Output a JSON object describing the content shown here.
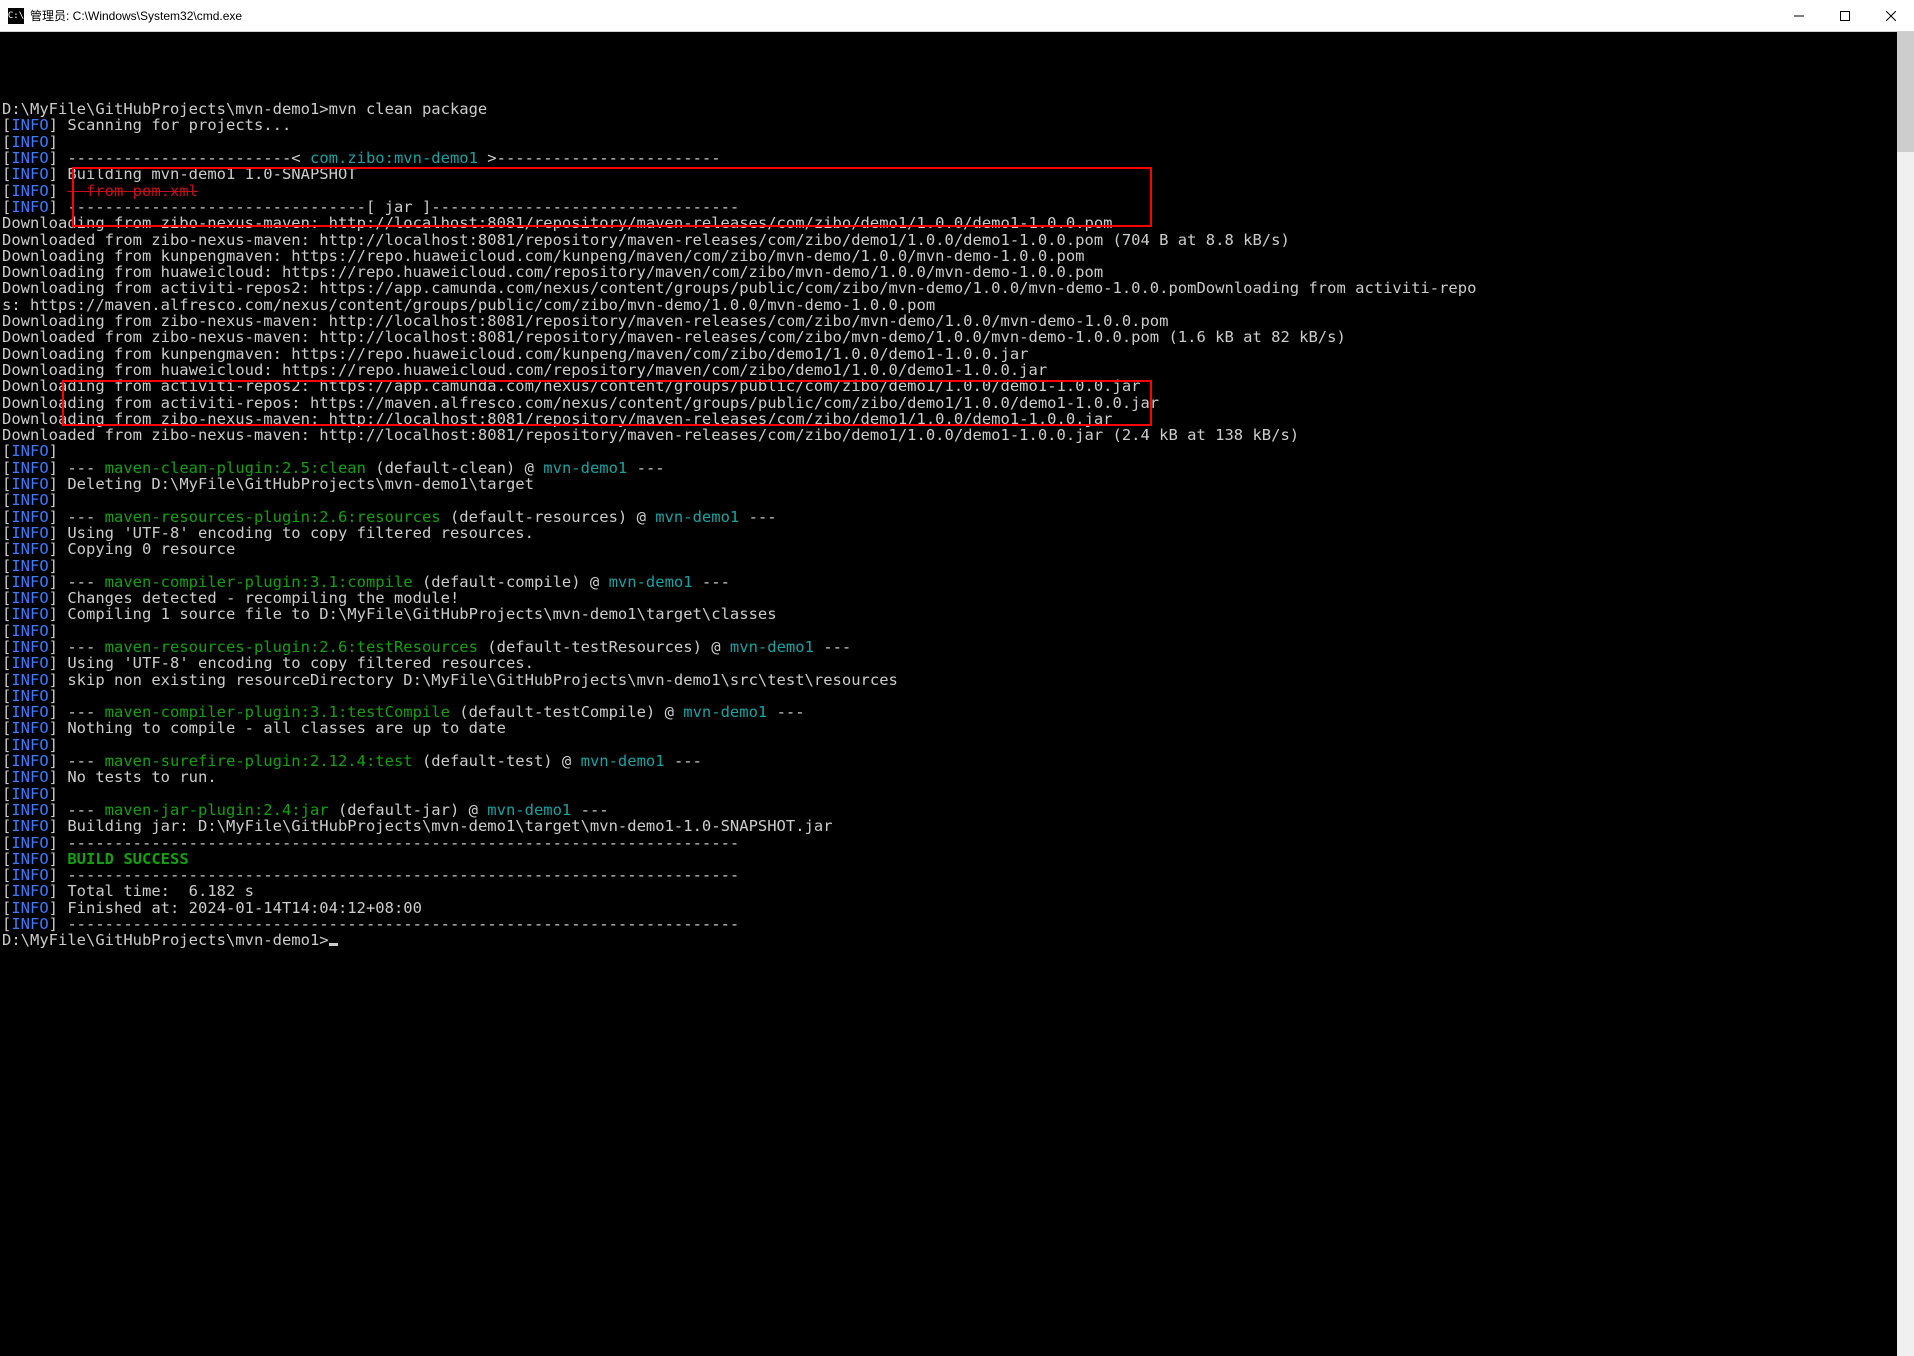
{
  "window": {
    "title": "管理员: C:\\Windows\\System32\\cmd.exe",
    "icon_glyph": "C:\\"
  },
  "prompt": {
    "path": "D:\\MyFile\\GitHubProjects\\mvn-demo1>",
    "command": "mvn clean package"
  },
  "lines": [
    {
      "type": "info",
      "text": "Scanning for projects..."
    },
    {
      "type": "info",
      "text": ""
    },
    {
      "type": "info-rule",
      "pre": "------------------------< ",
      "mid": "com.zibo:mvn-demo1",
      "post": " >------------------------"
    },
    {
      "type": "info",
      "text": "Building mvn-demo1 1.0-SNAPSHOT"
    },
    {
      "type": "info-strike",
      "strike": "  from pom.xml"
    },
    {
      "type": "info",
      "text": "--------------------------------[ jar ]---------------------------------"
    },
    {
      "type": "plain",
      "text": "Downloading from zibo-nexus-maven: http://localhost:8081/repository/maven-releases/com/zibo/demo1/1.0.0/demo1-1.0.0.pom"
    },
    {
      "type": "plain",
      "text": "Downloaded from zibo-nexus-maven: http://localhost:8081/repository/maven-releases/com/zibo/demo1/1.0.0/demo1-1.0.0.pom (704 B at 8.8 kB/s)"
    },
    {
      "type": "plain",
      "text": "Downloading from kunpengmaven: https://repo.huaweicloud.com/kunpeng/maven/com/zibo/mvn-demo/1.0.0/mvn-demo-1.0.0.pom"
    },
    {
      "type": "plain",
      "text": "Downloading from huaweicloud: https://repo.huaweicloud.com/repository/maven/com/zibo/mvn-demo/1.0.0/mvn-demo-1.0.0.pom"
    },
    {
      "type": "plain",
      "text": "Downloading from activiti-repos2: https://app.camunda.com/nexus/content/groups/public/com/zibo/mvn-demo/1.0.0/mvn-demo-1.0.0.pomDownloading from activiti-repos: https://maven.alfresco.com/nexus/content/groups/public/com/zibo/mvn-demo/1.0.0/mvn-demo-1.0.0.pom"
    },
    {
      "type": "plain",
      "text": "Downloading from zibo-nexus-maven: http://localhost:8081/repository/maven-releases/com/zibo/mvn-demo/1.0.0/mvn-demo-1.0.0.pom"
    },
    {
      "type": "plain",
      "text": "Downloaded from zibo-nexus-maven: http://localhost:8081/repository/maven-releases/com/zibo/mvn-demo/1.0.0/mvn-demo-1.0.0.pom (1.6 kB at 82 kB/s)"
    },
    {
      "type": "plain",
      "text": "Downloading from kunpengmaven: https://repo.huaweicloud.com/kunpeng/maven/com/zibo/demo1/1.0.0/demo1-1.0.0.jar"
    },
    {
      "type": "plain",
      "text": "Downloading from huaweicloud: https://repo.huaweicloud.com/repository/maven/com/zibo/demo1/1.0.0/demo1-1.0.0.jar"
    },
    {
      "type": "plain",
      "text": "Downloading from activiti-repos2: https://app.camunda.com/nexus/content/groups/public/com/zibo/demo1/1.0.0/demo1-1.0.0.jar"
    },
    {
      "type": "plain",
      "text": "Downloading from activiti-repos: https://maven.alfresco.com/nexus/content/groups/public/com/zibo/demo1/1.0.0/demo1-1.0.0.jar"
    },
    {
      "type": "plain",
      "text": "Downloading from zibo-nexus-maven: http://localhost:8081/repository/maven-releases/com/zibo/demo1/1.0.0/demo1-1.0.0.jar"
    },
    {
      "type": "plain",
      "text": "Downloaded from zibo-nexus-maven: http://localhost:8081/repository/maven-releases/com/zibo/demo1/1.0.0/demo1-1.0.0.jar (2.4 kB at 138 kB/s)"
    },
    {
      "type": "info",
      "text": ""
    },
    {
      "type": "info-plugin",
      "pre": "--- ",
      "plugin": "maven-clean-plugin:2.5:clean",
      "mid": " (default-clean) @ ",
      "proj": "mvn-demo1",
      "post": " ---"
    },
    {
      "type": "info",
      "text": "Deleting D:\\MyFile\\GitHubProjects\\mvn-demo1\\target"
    },
    {
      "type": "info",
      "text": ""
    },
    {
      "type": "info-plugin",
      "pre": "--- ",
      "plugin": "maven-resources-plugin:2.6:resources",
      "mid": " (default-resources) @ ",
      "proj": "mvn-demo1",
      "post": " ---"
    },
    {
      "type": "info",
      "text": "Using 'UTF-8' encoding to copy filtered resources."
    },
    {
      "type": "info",
      "text": "Copying 0 resource"
    },
    {
      "type": "info",
      "text": ""
    },
    {
      "type": "info-plugin",
      "pre": "--- ",
      "plugin": "maven-compiler-plugin:3.1:compile",
      "mid": " (default-compile) @ ",
      "proj": "mvn-demo1",
      "post": " ---"
    },
    {
      "type": "info",
      "text": "Changes detected - recompiling the module!"
    },
    {
      "type": "info",
      "text": "Compiling 1 source file to D:\\MyFile\\GitHubProjects\\mvn-demo1\\target\\classes"
    },
    {
      "type": "info",
      "text": ""
    },
    {
      "type": "info-plugin",
      "pre": "--- ",
      "plugin": "maven-resources-plugin:2.6:testResources",
      "mid": " (default-testResources) @ ",
      "proj": "mvn-demo1",
      "post": " ---"
    },
    {
      "type": "info",
      "text": "Using 'UTF-8' encoding to copy filtered resources."
    },
    {
      "type": "info",
      "text": "skip non existing resourceDirectory D:\\MyFile\\GitHubProjects\\mvn-demo1\\src\\test\\resources"
    },
    {
      "type": "info",
      "text": ""
    },
    {
      "type": "info-plugin",
      "pre": "--- ",
      "plugin": "maven-compiler-plugin:3.1:testCompile",
      "mid": " (default-testCompile) @ ",
      "proj": "mvn-demo1",
      "post": " ---"
    },
    {
      "type": "info",
      "text": "Nothing to compile - all classes are up to date"
    },
    {
      "type": "info",
      "text": ""
    },
    {
      "type": "info-plugin",
      "pre": "--- ",
      "plugin": "maven-surefire-plugin:2.12.4:test",
      "mid": " (default-test) @ ",
      "proj": "mvn-demo1",
      "post": " ---"
    },
    {
      "type": "info",
      "text": "No tests to run."
    },
    {
      "type": "info",
      "text": ""
    },
    {
      "type": "info-plugin",
      "pre": "--- ",
      "plugin": "maven-jar-plugin:2.4:jar",
      "mid": " (default-jar) @ ",
      "proj": "mvn-demo1",
      "post": " ---"
    },
    {
      "type": "info",
      "text": "Building jar: D:\\MyFile\\GitHubProjects\\mvn-demo1\\target\\mvn-demo1-1.0-SNAPSHOT.jar"
    },
    {
      "type": "info",
      "text": "------------------------------------------------------------------------"
    },
    {
      "type": "info-success",
      "text": "BUILD SUCCESS"
    },
    {
      "type": "info",
      "text": "------------------------------------------------------------------------"
    },
    {
      "type": "info",
      "text": "Total time:  6.182 s"
    },
    {
      "type": "info",
      "text": "Finished at: 2024-01-14T14:04:12+08:00"
    },
    {
      "type": "info",
      "text": "------------------------------------------------------------------------"
    }
  ],
  "end_prompt": "D:\\MyFile\\GitHubProjects\\mvn-demo1>"
}
